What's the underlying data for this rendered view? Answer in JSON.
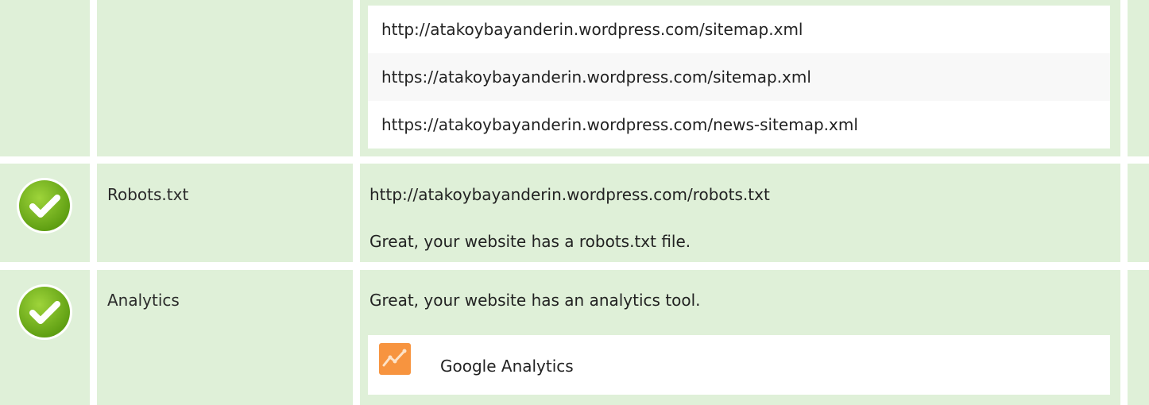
{
  "sitemaps": {
    "urls": [
      "http://atakoybayanderin.wordpress.com/sitemap.xml",
      "https://atakoybayanderin.wordpress.com/sitemap.xml",
      "https://atakoybayanderin.wordpress.com/news-sitemap.xml"
    ]
  },
  "robots": {
    "label": "Robots.txt",
    "url": "http://atakoybayanderin.wordpress.com/robots.txt",
    "message": "Great, your website has a robots.txt file.",
    "status_icon": "check-icon"
  },
  "analytics": {
    "label": "Analytics",
    "message": "Great, your website has an analytics tool.",
    "status_icon": "check-icon",
    "tools": [
      {
        "name": "Google Analytics",
        "icon": "google-analytics-icon"
      }
    ]
  },
  "colors": {
    "row_bg": "#dff0d8",
    "check_green": "#7cbd1c",
    "analytics_orange": "#f7943f"
  }
}
